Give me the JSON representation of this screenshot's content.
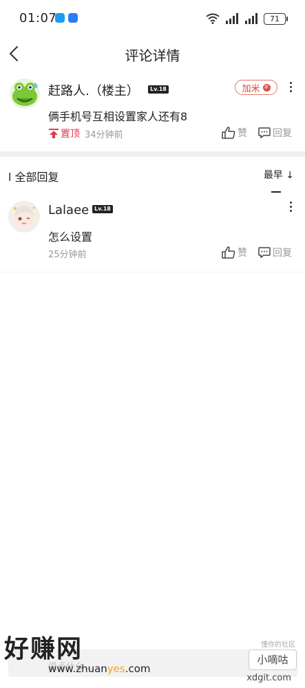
{
  "status": {
    "time": "01:07",
    "battery": "71"
  },
  "nav": {
    "title": "评论详情"
  },
  "main_comment": {
    "username": "赶路人.（楼主）",
    "level": "Lv.18",
    "follow_label": "加米",
    "follow_badge": "不",
    "text": "俩手机号互相设置家人还有8",
    "pin_label": "置顶",
    "time": "34分钟前",
    "like_label": "赞",
    "reply_label": "回复"
  },
  "replies_section": {
    "title": "l 全部回复",
    "sort_label": "最早 ↓"
  },
  "replies": [
    {
      "username": "Lalaee",
      "level": "Lv.18",
      "text": "怎么设置",
      "time": "25分钟前",
      "like_label": "赞",
      "reply_label": "回复"
    }
  ],
  "bottom": {
    "placeholder": "说点什么..."
  },
  "watermarks": {
    "left_brand": "好赚网",
    "left_url_a": "www.zhuan",
    "left_url_hl": "yes",
    "left_url_b": ".com",
    "right_top": "懂你的社区",
    "right_brand": "小嘀咕",
    "right_url": "xdgit.com"
  },
  "colors": {
    "accent_red": "#d24a3a",
    "pin_red": "#e0394d",
    "muted": "#999999",
    "band": "#f0f0f0"
  }
}
